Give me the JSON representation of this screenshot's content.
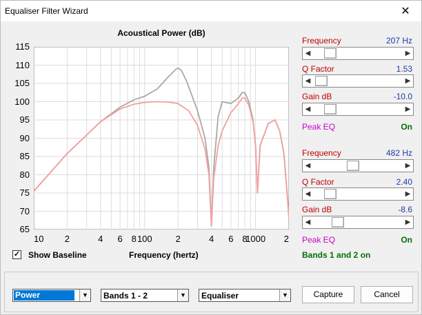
{
  "window": {
    "title": "Equaliser Filter Wizard",
    "close_glyph": "✕"
  },
  "chart_data": {
    "type": "line",
    "title": "Acoustical Power (dB)",
    "xlabel": "Frequency (hertz)",
    "ylabel": "",
    "x_scale": "log",
    "xlim": [
      10,
      2000
    ],
    "ylim": [
      65,
      115
    ],
    "y_ticks": [
      "115",
      "110",
      "105",
      "100",
      "95",
      "90",
      "85",
      "80",
      "75",
      "70",
      "65"
    ],
    "x_ticks": [
      "10",
      "2",
      "4",
      "6",
      "8",
      "100",
      "2",
      "4",
      "6",
      "8",
      "1000",
      "2"
    ],
    "grid": true,
    "series": [
      {
        "color": "#a8a8a8",
        "x": [
          10,
          20,
          40,
          60,
          80,
          100,
          130,
          160,
          190,
          200,
          215,
          240,
          300,
          350,
          380,
          400,
          420,
          460,
          500,
          600,
          700,
          760,
          800,
          870,
          950,
          1000,
          1040,
          1100,
          1300,
          1500,
          1650,
          1800,
          1950,
          2000
        ],
        "y": [
          75.5,
          85.8,
          94.5,
          98.5,
          100.5,
          101.5,
          103.5,
          106.5,
          108.8,
          109.2,
          108.5,
          105.5,
          97.5,
          90.0,
          82.0,
          66.0,
          82.0,
          96.0,
          100.0,
          99.5,
          101.0,
          102.5,
          102.5,
          100.0,
          95.0,
          88.0,
          75.0,
          88.0,
          94.0,
          95.0,
          92.0,
          86.0,
          73.0,
          68.0
        ]
      },
      {
        "color": "#f2a0a0",
        "x": [
          10,
          20,
          40,
          60,
          80,
          100,
          130,
          160,
          200,
          250,
          300,
          350,
          380,
          400,
          420,
          460,
          500,
          600,
          700,
          760,
          800,
          870,
          950,
          1000,
          1040,
          1100,
          1300,
          1500,
          1650,
          1800,
          1950,
          2000
        ],
        "y": [
          75.5,
          85.8,
          94.5,
          98.0,
          99.3,
          99.8,
          100.0,
          99.9,
          99.5,
          97.5,
          93.5,
          87.0,
          80.0,
          66.0,
          79.0,
          88.0,
          92.0,
          97.0,
          99.5,
          101.0,
          101.0,
          99.0,
          94.5,
          88.0,
          75.0,
          88.0,
          94.0,
          95.0,
          92.0,
          86.0,
          73.0,
          68.0
        ]
      }
    ]
  },
  "controls": {
    "show_baseline_label": "Show Baseline",
    "show_baseline_checked": "✓",
    "band1": {
      "frequency_label": "Frequency",
      "frequency_value": "207 Hz",
      "frequency_pos": 0.14,
      "q_label": "Q Factor",
      "q_value": "1.53",
      "q_pos": 0.03,
      "gain_label": "Gain  dB",
      "gain_value": "-10.0",
      "gain_pos": 0.14,
      "type_label": "Peak EQ",
      "state": "On"
    },
    "band2": {
      "frequency_label": "Frequency",
      "frequency_value": "482 Hz",
      "frequency_pos": 0.44,
      "q_label": "Q Factor",
      "q_value": "2.40",
      "q_pos": 0.14,
      "gain_label": "Gain  dB",
      "gain_value": "-8.6",
      "gain_pos": 0.24,
      "type_label": "Peak EQ",
      "state": "On"
    },
    "bands_status": "Bands 1 and 2 on"
  },
  "bottom": {
    "mode_select": "Power",
    "bands_select": "Bands 1 - 2",
    "filter_select": "Equaliser",
    "capture_label": "Capture",
    "cancel_label": "Cancel"
  }
}
